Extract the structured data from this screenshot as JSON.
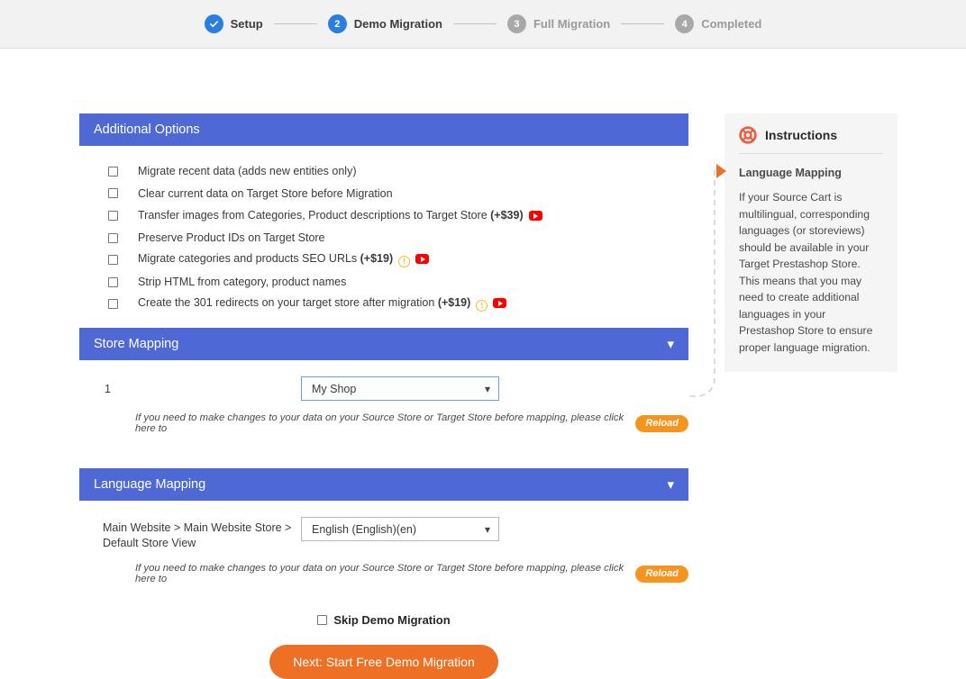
{
  "stepper": {
    "steps": [
      {
        "id": "setup",
        "marker": "check",
        "label": "Setup",
        "state": "done"
      },
      {
        "id": "demo-migration",
        "marker": "2",
        "label": "Demo Migration",
        "state": "active"
      },
      {
        "id": "full-migration",
        "marker": "3",
        "label": "Full Migration",
        "state": "pending"
      },
      {
        "id": "completed",
        "marker": "4",
        "label": "Completed",
        "state": "pending"
      }
    ]
  },
  "additional_options": {
    "title": "Additional Options",
    "options": [
      {
        "label": "Migrate recent data (adds new entities only)",
        "price": "",
        "info": false,
        "video": false,
        "checked": false
      },
      {
        "label": "Clear current data on Target Store before Migration",
        "price": "",
        "info": false,
        "video": false,
        "checked": false
      },
      {
        "label": "Transfer images from Categories, Product descriptions to Target Store",
        "price": "(+$39)",
        "info": false,
        "video": true,
        "checked": false
      },
      {
        "label": "Preserve Product IDs on Target Store",
        "price": "",
        "info": false,
        "video": false,
        "checked": false
      },
      {
        "label": "Migrate categories and products SEO URLs",
        "price": "(+$19)",
        "info": true,
        "video": true,
        "checked": false
      },
      {
        "label": "Strip HTML from category, product names",
        "price": "",
        "info": false,
        "video": false,
        "checked": false
      },
      {
        "label": "Create the 301 redirects on your target store after migration",
        "price": "(+$19)",
        "info": true,
        "video": true,
        "checked": false
      }
    ]
  },
  "store_mapping": {
    "title": "Store Mapping",
    "collapse_icon": "chevron-down-icon",
    "row_label": "1",
    "select_value": "My Shop",
    "hint": "If you need to make changes to your data on your Source Store or Target Store before mapping, please click here to",
    "reload_label": "Reload"
  },
  "language_mapping": {
    "title": "Language Mapping",
    "collapse_icon": "chevron-down-icon",
    "row_label": "Main Website > Main Website Store > Default Store View",
    "select_value": "English (English)(en)",
    "hint": "If you need to make changes to your data on your Source Store or Target Store before mapping, please click here to",
    "reload_label": "Reload"
  },
  "footer": {
    "skip_label": "Skip Demo Migration",
    "skip_checked": false,
    "cta_label": "Next: Start Free Demo Migration"
  },
  "instructions": {
    "icon": "lifebuoy-icon",
    "title": "Instructions",
    "subtitle": "Language Mapping",
    "body": "If your Source Cart is multilingual, corresponding languages (or storeviews) should be available in your Target Prestashop Store. This means that you may need to create additional languages in your Prestashop Store to ensure proper language migration."
  },
  "colors": {
    "panel_header": "#4e68d4",
    "accent_orange": "#ee7024",
    "reload_orange": "#f7941e",
    "step_active": "#2a7de1",
    "step_pending": "#a8a8a8",
    "info_yellow": "#f2bd2e",
    "youtube_red": "#ff0000",
    "instructions_bg": "#f5f5f5",
    "stepper_bg": "#f2f2f2"
  }
}
